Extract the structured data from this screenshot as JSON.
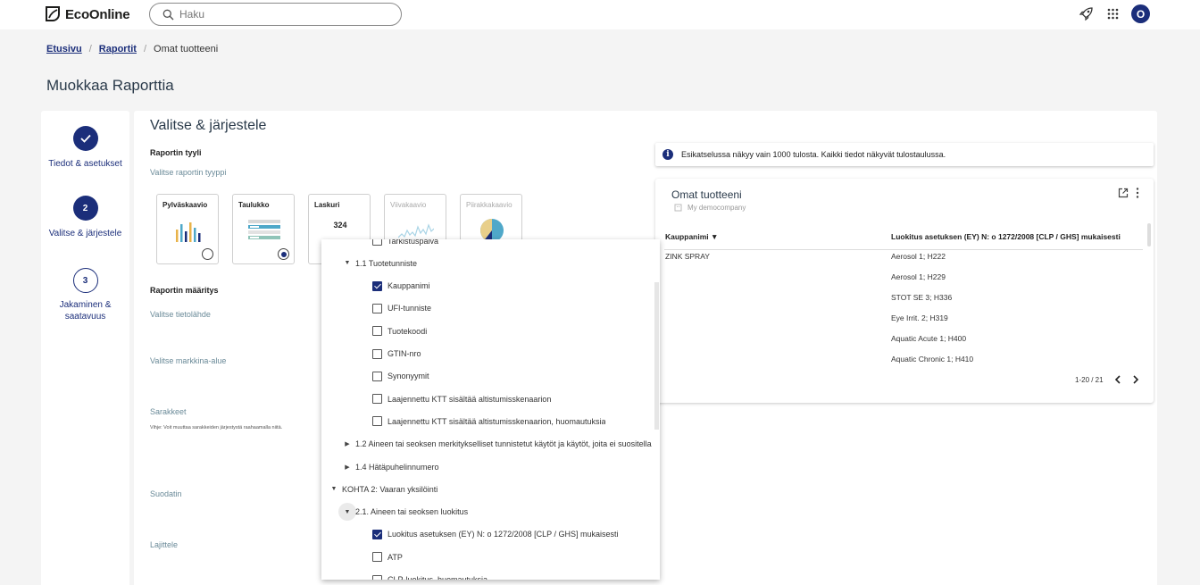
{
  "header": {
    "brand": "EcoOnline",
    "search_placeholder": "Haku",
    "avatar_initial": "O"
  },
  "breadcrumb": {
    "home": "Etusivu",
    "reports": "Raportit",
    "current": "Omat tuotteeni"
  },
  "page_title": "Muokkaa Raporttia",
  "stepper": {
    "steps": [
      {
        "number": "",
        "label": "Tiedot & asetukset",
        "state": "done"
      },
      {
        "number": "2",
        "label": "Valitse & järjestele",
        "state": "active"
      },
      {
        "number": "3",
        "label": "Jakaminen & saatavuus",
        "state": "todo"
      }
    ]
  },
  "main": {
    "title": "Valitse & järjestele",
    "style_label": "Raportin tyyli",
    "style_sub": "Valitse raportin tyyppi",
    "types": [
      {
        "name": "Pylväskaavio",
        "selected": false,
        "disabled": false
      },
      {
        "name": "Taulukko",
        "selected": true,
        "disabled": false
      },
      {
        "name": "Laskuri",
        "value": "324",
        "selected": false,
        "disabled": false
      },
      {
        "name": "Viivakaavio",
        "selected": false,
        "disabled": true
      },
      {
        "name": "Piirakkakaavio",
        "selected": false,
        "disabled": true
      }
    ],
    "definition_label": "Raportin määritys",
    "datasource_label": "Valitse tietolähde",
    "market_label": "Valitse markkina-alue",
    "columns_label": "Sarakkeet",
    "columns_hint": "Vihje: Voit muuttaa sarakkeiden järjestystä raahaamalla niitä.",
    "filter_label": "Suodatin",
    "sort_label": "Lajittele"
  },
  "info_banner": "Esikatselussa näkyy vain 1000 tulosta. Kaikki tiedot näkyvät tulostaulussa.",
  "preview": {
    "title": "Omat tuotteeni",
    "company": "My democompany",
    "columns": [
      "Kauppanimi ▼",
      "Luokitus asetuksen (EY) N: o 1272/2008 [CLP / GHS] mukaisesti"
    ],
    "product": "ZINK SPRAY",
    "classifications": [
      "Aerosol 1; H222",
      "Aerosol 1; H229",
      "STOT SE 3; H336",
      "Eye Irrit. 2; H319",
      "Aquatic Acute 1; H400",
      "Aquatic Chronic 1; H410"
    ],
    "pager": "1-20 / 21"
  },
  "dropdown": {
    "items": [
      {
        "type": "check",
        "label": "Tarkistuspäivä",
        "checked": false,
        "level": 2
      },
      {
        "type": "group",
        "label": "1.1 Tuotetunniste",
        "expanded": true,
        "level": 1
      },
      {
        "type": "check",
        "label": "Kauppanimi",
        "checked": true,
        "level": 2
      },
      {
        "type": "check",
        "label": "UFI-tunniste",
        "checked": false,
        "level": 2
      },
      {
        "type": "check",
        "label": "Tuotekoodi",
        "checked": false,
        "level": 2
      },
      {
        "type": "check",
        "label": "GTIN-nro",
        "checked": false,
        "level": 2
      },
      {
        "type": "check",
        "label": "Synonyymit",
        "checked": false,
        "level": 2
      },
      {
        "type": "check",
        "label": "Laajennettu KTT sisältää altistumisskenaarion",
        "checked": false,
        "level": 2
      },
      {
        "type": "check",
        "label": "Laajennettu KTT sisältää altistumisskenaarion, huomautuksia",
        "checked": false,
        "level": 2
      },
      {
        "type": "group",
        "label": "1.2 Aineen tai seoksen merkitykselliset tunnistetut käytöt ja käytöt, joita ei suositella",
        "expanded": false,
        "level": 1
      },
      {
        "type": "group",
        "label": "1.4 Hätäpuhelinnumero",
        "expanded": false,
        "level": 1
      },
      {
        "type": "group",
        "label": "KOHTA 2: Vaaran yksilöinti",
        "expanded": true,
        "level": 0
      },
      {
        "type": "group",
        "label": "2.1. Aineen tai seoksen luokitus",
        "expanded": true,
        "level": 1,
        "hover": true
      },
      {
        "type": "check",
        "label": "Luokitus asetuksen (EY) N: o 1272/2008 [CLP / GHS] mukaisesti",
        "checked": true,
        "level": 2
      },
      {
        "type": "check",
        "label": "ATP",
        "checked": false,
        "level": 2
      },
      {
        "type": "check",
        "label": "CLP-luokitus, huomautuksia",
        "checked": false,
        "level": 2
      }
    ]
  },
  "colors": {
    "accent": "#1b2e7a",
    "background": "#f4f4f4",
    "label_muted": "#6a8a98"
  }
}
